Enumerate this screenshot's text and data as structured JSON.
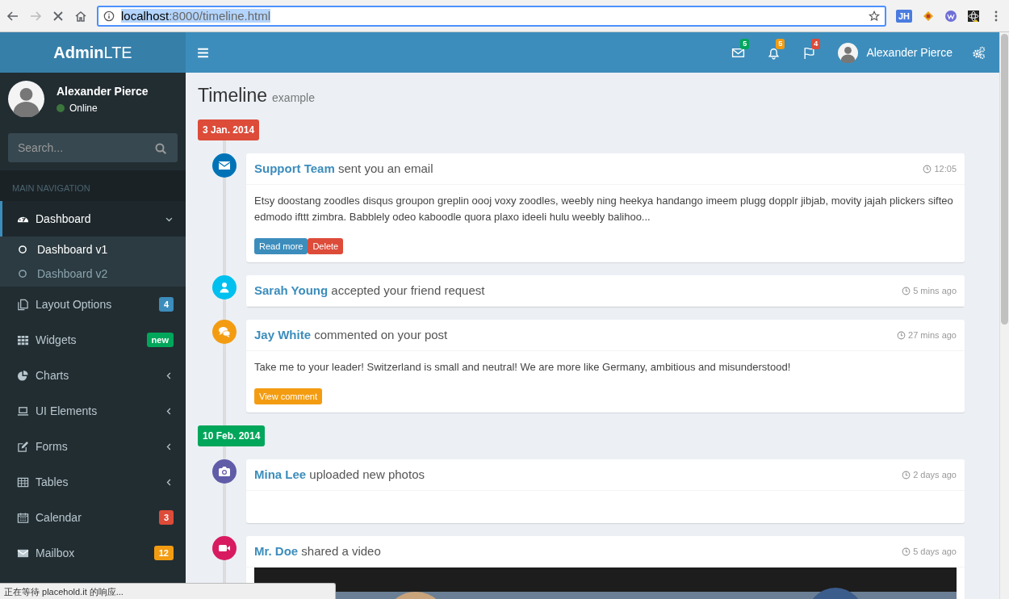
{
  "browser": {
    "url_host": "localhost",
    "url_rest": ":8000/timeline.html",
    "extension_label": "JH"
  },
  "header": {
    "logo_bold": "Admin",
    "logo_light": "LTE",
    "user": "Alexander Pierce",
    "notifications": [
      {
        "kind": "mail",
        "count": "5",
        "color": "#00a65a"
      },
      {
        "kind": "bell",
        "count": "5",
        "color": "#f39c12"
      },
      {
        "kind": "flag",
        "count": "4",
        "color": "#dd4b39"
      }
    ]
  },
  "sidebar": {
    "user": {
      "name": "Alexander Pierce",
      "status": "Online"
    },
    "search": {
      "placeholder": "Search..."
    },
    "section": "MAIN NAVIGATION",
    "items": [
      {
        "label": "Dashboard",
        "kind": "submenu",
        "expanded": true,
        "selected": true,
        "children": [
          {
            "label": "Dashboard v1",
            "selected": true
          },
          {
            "label": "Dashboard v2",
            "selected": false
          }
        ]
      },
      {
        "label": "Layout Options",
        "kind": "link",
        "selected": false,
        "badge": "4",
        "color": "#3c8dbc"
      },
      {
        "label": "Widgets",
        "kind": "link",
        "selected": false,
        "badge": "new",
        "color": "#00a65a"
      },
      {
        "label": "Charts",
        "kind": "submenu",
        "expanded": false,
        "selected": false
      },
      {
        "label": "UI Elements",
        "kind": "submenu",
        "expanded": false,
        "selected": false
      },
      {
        "label": "Forms",
        "kind": "submenu",
        "expanded": false,
        "selected": false
      },
      {
        "label": "Tables",
        "kind": "submenu",
        "expanded": false,
        "selected": false
      },
      {
        "label": "Calendar",
        "kind": "link",
        "selected": false,
        "badge": "3",
        "color": "#dd4b39"
      },
      {
        "label": "Mailbox",
        "kind": "link",
        "selected": false,
        "badge": "12",
        "color": "#f39c12"
      }
    ]
  },
  "page": {
    "title": "Timeline",
    "subtitle": "example"
  },
  "timeline": [
    {
      "kind": "date",
      "text": "3 Jan. 2014",
      "color": "#dd4b39"
    },
    {
      "kind": "email",
      "color": "#0073b7",
      "author": "Support Team",
      "action": "sent you an email",
      "time": "12:05",
      "body": "Etsy doostang zoodles disqus groupon greplin oooj voxy zoodles, weebly ning heekya handango imeem plugg dopplr jibjab, movity jajah plickers sifteo edmodo ifttt zimbra. Babblely odeo kaboodle quora plaxo ideeli hulu weebly balihoo...",
      "buttons": [
        {
          "label": "Read more",
          "color": "#3c8dbc"
        },
        {
          "label": "Delete",
          "color": "#dd4b39"
        }
      ]
    },
    {
      "kind": "friend",
      "color": "#00c0ef",
      "author": "Sarah Young",
      "action": "accepted your friend request",
      "time": "5 mins ago"
    },
    {
      "kind": "comment",
      "color": "#f39c12",
      "author": "Jay White",
      "action": "commented on your post",
      "time": "27 mins ago",
      "body": "Take me to your leader! Switzerland is small and neutral! We are more like Germany, ambitious and misunderstood!",
      "buttons": [
        {
          "label": "View comment",
          "color": "#f39c12"
        }
      ]
    },
    {
      "kind": "date",
      "text": "10 Feb. 2014",
      "color": "#00a65a"
    },
    {
      "kind": "photos",
      "color": "#605ca8",
      "author": "Mina Lee",
      "action": "uploaded new photos",
      "time": "2 days ago"
    },
    {
      "kind": "video",
      "color": "#d81b60",
      "author": "Mr. Doe",
      "action": "shared a video",
      "time": "5 days ago"
    }
  ],
  "status_bar": "正在等待 placehold.it 的响应..."
}
